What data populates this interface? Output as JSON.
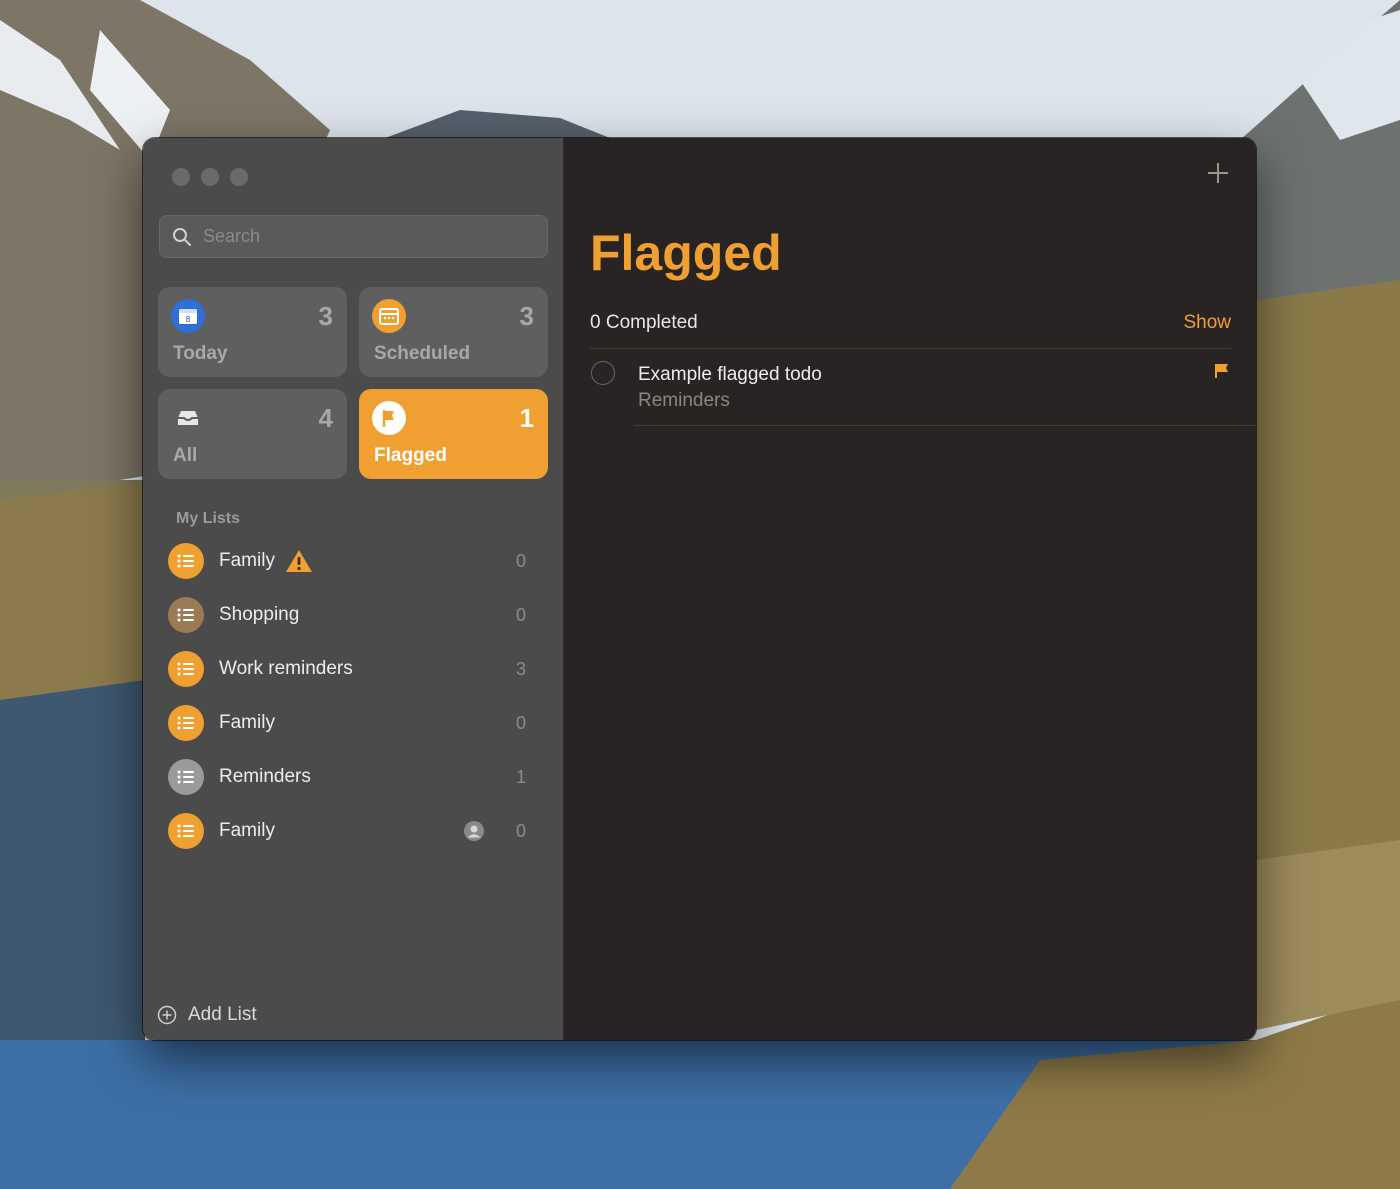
{
  "sidebar": {
    "search": {
      "placeholder": "Search"
    },
    "smart_lists": [
      {
        "label": "Today",
        "count": "3",
        "icon": "calendar-icon",
        "icon_text": "8",
        "color": "#2f6fd6"
      },
      {
        "label": "Scheduled",
        "count": "3",
        "icon": "calendar-clock-icon",
        "color": "#f0a030"
      },
      {
        "label": "All",
        "count": "4",
        "icon": "tray-icon",
        "color": "#5f5f5f"
      },
      {
        "label": "Flagged",
        "count": "1",
        "icon": "flag-icon",
        "color": "#f0a030",
        "selected": true
      }
    ],
    "my_lists_title": "My Lists",
    "lists": [
      {
        "name": "Family",
        "count": "0",
        "color": "#f0a030",
        "warning": true
      },
      {
        "name": "Shopping",
        "count": "0",
        "color": "#9a7b54"
      },
      {
        "name": "Work reminders",
        "count": "3",
        "color": "#f0a030"
      },
      {
        "name": "Family",
        "count": "0",
        "color": "#f0a030"
      },
      {
        "name": "Reminders",
        "count": "1",
        "color": "#9a9a9a"
      },
      {
        "name": "Family",
        "count": "0",
        "color": "#f0a030",
        "shared": true
      }
    ],
    "add_list_label": "Add List"
  },
  "main": {
    "title": "Flagged",
    "completed_text": "0 Completed",
    "show_label": "Show",
    "todos": [
      {
        "title": "Example flagged todo",
        "list": "Reminders",
        "flagged": true
      }
    ]
  },
  "colors": {
    "accent": "#f0a030",
    "sidebar_bg": "#4b4b4b",
    "main_bg": "#272423"
  }
}
